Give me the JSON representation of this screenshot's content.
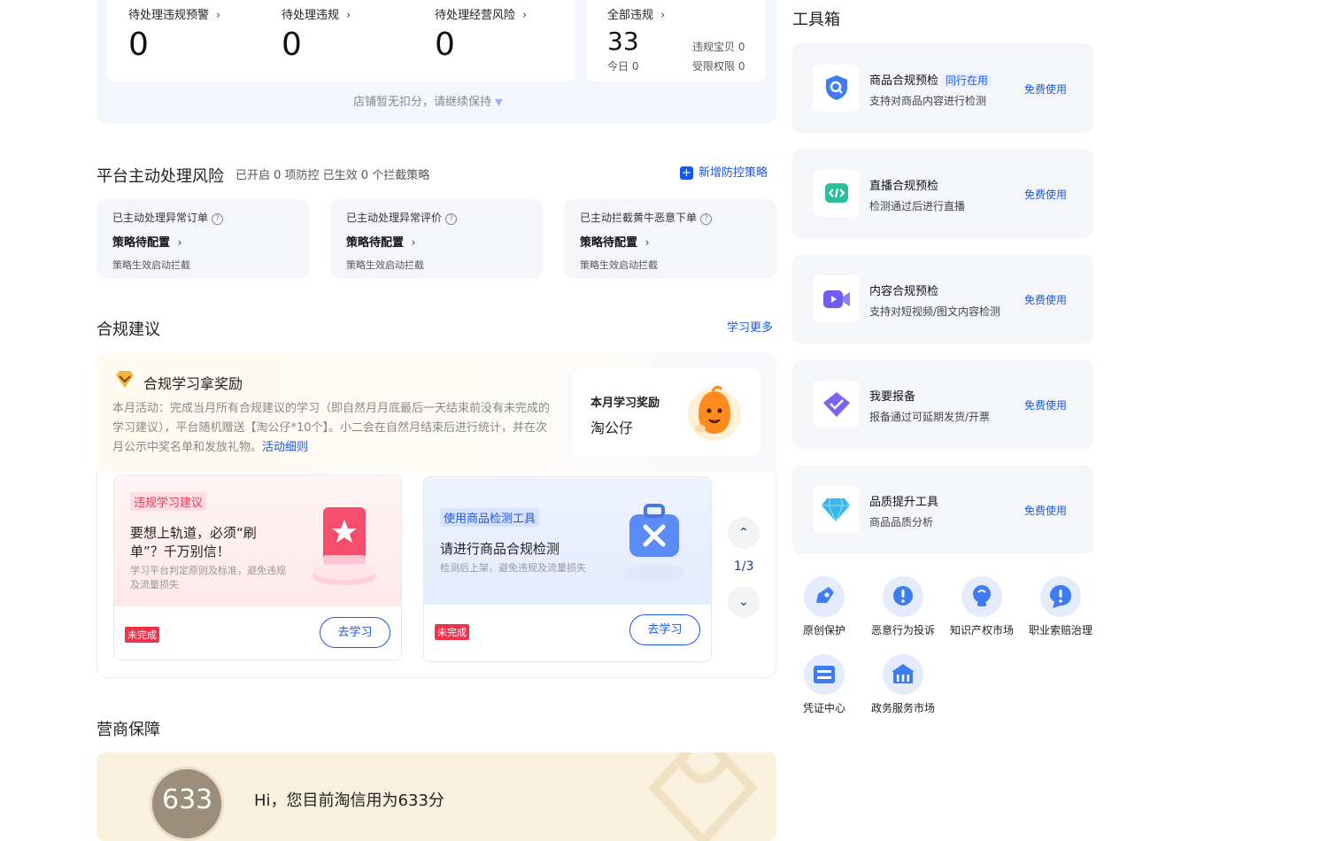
{
  "stats": {
    "items": [
      {
        "label": "待处理违规预警",
        "value": "0"
      },
      {
        "label": "待处理违规",
        "value": "0"
      },
      {
        "label": "待处理经营风险",
        "value": "0"
      }
    ],
    "all": {
      "label": "全部违规",
      "value": "33",
      "today": "今日 0",
      "items_violated": "违规宝贝 0",
      "restricted": "受限权限 0"
    },
    "footer": "店铺暂无扣分，请继续保持"
  },
  "platform_risk": {
    "title": "平台主动处理风险",
    "info": "已开启 0 项防控 已生效 0 个拦截策略",
    "add_label": "新增防控策略",
    "cards": [
      {
        "title": "已主动处理异常订单",
        "status": "策略待配置",
        "desc": "策略生效启动拦截"
      },
      {
        "title": "已主动处理异常评价",
        "status": "策略待配置",
        "desc": "策略生效启动拦截"
      },
      {
        "title": "已主动拦截黄牛恶意下单",
        "status": "策略待配置",
        "desc": "策略生效启动拦截"
      }
    ]
  },
  "advice": {
    "title": "合规建议",
    "more": "学习更多",
    "reward_title": "合规学习拿奖励",
    "reward_desc": "本月活动：完成当月所有合规建议的学习（即自然月月底最后一天结束前没有未完成的学习建议），平台随机赠送【淘公仔*10个】。小二会在自然月结束后进行统计，并在次月公示中奖名单和发放礼物。",
    "reward_link": "活动细则",
    "monthly_title": "本月学习奖励",
    "monthly_item": "淘公仔",
    "lessons": [
      {
        "tag": "违规学习建议",
        "title": "要想上轨道，必须“刷单”？千万别信！",
        "desc": "学习平台判定原则及标准，避免违规及流量损失",
        "status": "未完成",
        "button": "去学习"
      },
      {
        "tag": "使用商品检测工具",
        "title": "请进行商品合规检测",
        "desc": "检测后上架，避免违规及流量损失",
        "status": "未完成",
        "button": "去学习"
      }
    ],
    "pager": "1/3"
  },
  "guarantee": {
    "title": "营商保障",
    "score": "633",
    "greeting": "Hi，您目前淘信用为633分"
  },
  "toolbox": {
    "title": "工具箱",
    "tools": [
      {
        "name": "商品合规预检",
        "tag": "同行在用",
        "desc": "支持对商品内容进行检测",
        "action": "免费使用",
        "icon": "shield-search-icon"
      },
      {
        "name": "直播合规预检",
        "tag": "",
        "desc": "检测通过后进行直播",
        "action": "免费使用",
        "icon": "code-icon"
      },
      {
        "name": "内容合规预检",
        "tag": "",
        "desc": "支持对短视频/图文内容检测",
        "action": "免费使用",
        "icon": "video-icon"
      },
      {
        "name": "我要报备",
        "tag": "",
        "desc": "报备通过可延期发货/开票",
        "action": "免费使用",
        "icon": "report-check-icon"
      },
      {
        "name": "品质提升工具",
        "tag": "",
        "desc": "商品品质分析",
        "action": "免费使用",
        "icon": "diamond-icon"
      }
    ],
    "quick": [
      {
        "label": "原创保护",
        "icon": "pen-icon"
      },
      {
        "label": "恶意行为投诉",
        "icon": "alert-icon"
      },
      {
        "label": "知识产权市场",
        "icon": "bulb-icon"
      },
      {
        "label": "职业索赔治理",
        "icon": "warning-icon"
      },
      {
        "label": "凭证中心",
        "icon": "voucher-icon"
      },
      {
        "label": "政务服务市场",
        "icon": "government-icon"
      }
    ]
  }
}
